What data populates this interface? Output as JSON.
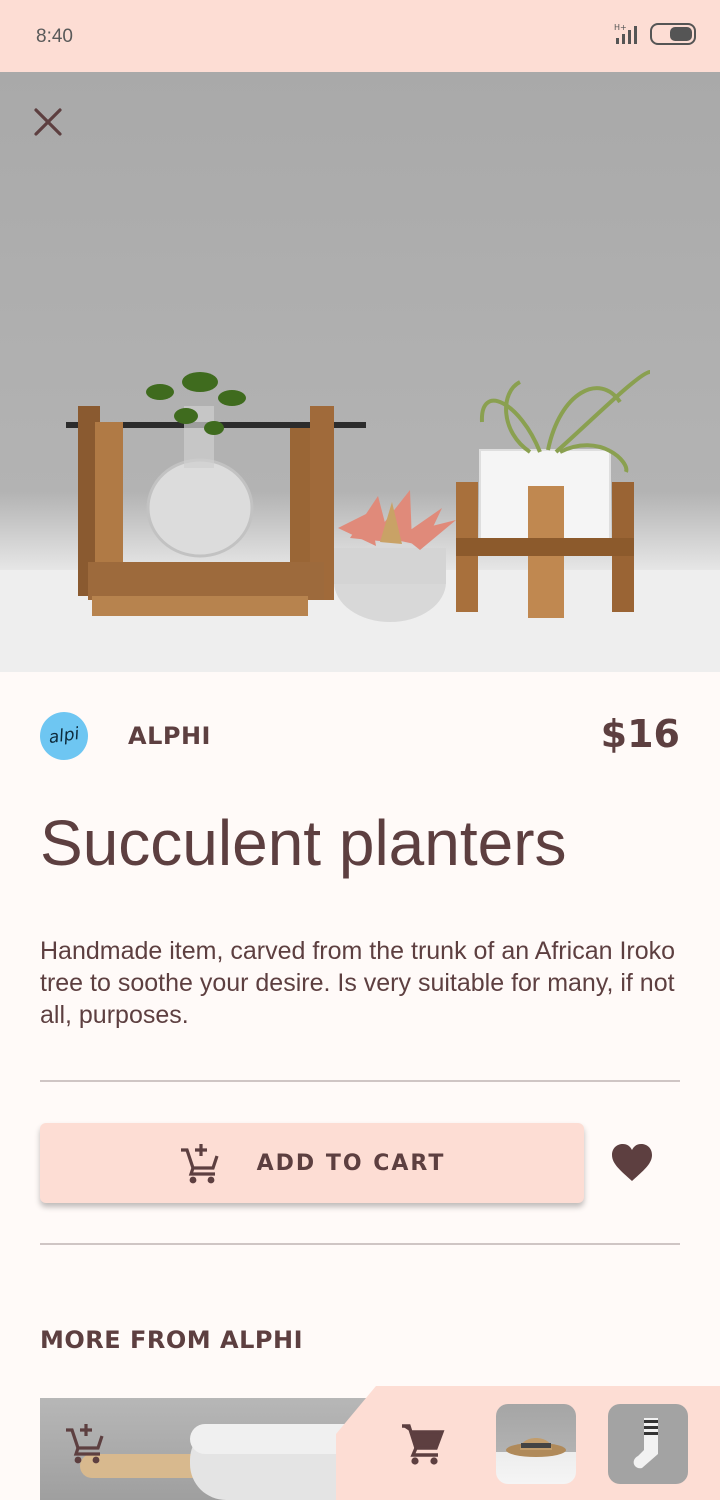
{
  "status_bar": {
    "time": "8:40"
  },
  "hero": {
    "image": "succulent planters on wooden stands"
  },
  "product": {
    "vendor_logo_text": "alpi",
    "vendor_name": "ALPHI",
    "price": "$16",
    "title": "Succulent planters",
    "description": "Handmade item, carved from the trunk of an African Iroko tree to soothe your desire. Is very suitable for many, if not all, purposes."
  },
  "actions": {
    "add_to_cart_label": "ADD TO CART"
  },
  "more": {
    "heading": "MORE FROM ALPHI"
  },
  "colors": {
    "accent": "#fdddd4",
    "text": "#5d3f40",
    "background": "#fffaf8",
    "logo": "#6ec6f2"
  },
  "icons": [
    "close-icon",
    "add-shopping-cart-icon",
    "heart-icon",
    "shopping-cart-icon",
    "signal-icon",
    "battery-icon"
  ]
}
